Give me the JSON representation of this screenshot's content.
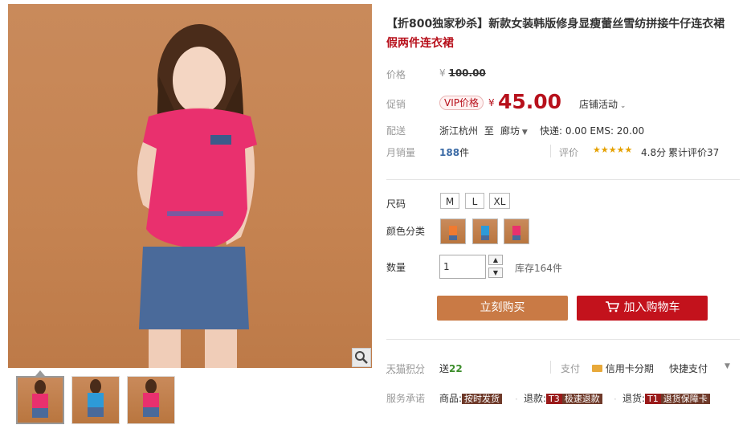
{
  "product": {
    "title_line1": "【折800独家秒杀】新款女装韩版修身显瘦蕾丝雪纺拼接牛仔连衣裙",
    "title_line2": "假两件连衣裙"
  },
  "price": {
    "label": "价格",
    "currency": "¥",
    "original": "100.00"
  },
  "promo": {
    "label": "促销",
    "badge": "VIP价格",
    "currency": "¥",
    "price": "45.00",
    "store_activity": "店铺活动"
  },
  "shipping": {
    "label": "配送",
    "from": "浙江杭州",
    "to_word": "至",
    "to": "廊坊",
    "express": "快递: 0.00 EMS: 20.00"
  },
  "sales": {
    "label": "月销量",
    "count": "188",
    "unit": "件",
    "rating_label": "评价",
    "stars": "★★★★★",
    "score": "4.8分",
    "cumulative": "累计评价37"
  },
  "size": {
    "label": "尺码",
    "options": [
      "M",
      "L",
      "XL"
    ]
  },
  "color": {
    "label": "颜色分类"
  },
  "quantity": {
    "label": "数量",
    "value": "1",
    "stock": "库存164件"
  },
  "buttons": {
    "buy_now": "立刻购买",
    "add_cart": "加入购物车"
  },
  "points": {
    "label": "天猫积分",
    "give": "送",
    "value": "22",
    "pay_label": "支付",
    "credit": "信用卡分期",
    "quick_pay": "快捷支付"
  },
  "service": {
    "label": "服务承诺",
    "goods_label": "商品:",
    "goods_tag": "按时发货",
    "refund_label": "退款:",
    "refund_code": "T3",
    "refund_tag": "极速退款",
    "return_label": "退货:",
    "return_code": "T1",
    "return_tag": "退货保障卡"
  },
  "colors": {
    "accent_red": "#b7101b",
    "buy_button": "#c97a45",
    "cart_button": "#c3121c",
    "top_pink": "#e9306e",
    "skirt_denim": "#4a6a9a"
  },
  "icons": [
    "search-zoom-icon",
    "cart-icon",
    "chevron-down-icon",
    "credit-card-icon",
    "star-icon"
  ]
}
